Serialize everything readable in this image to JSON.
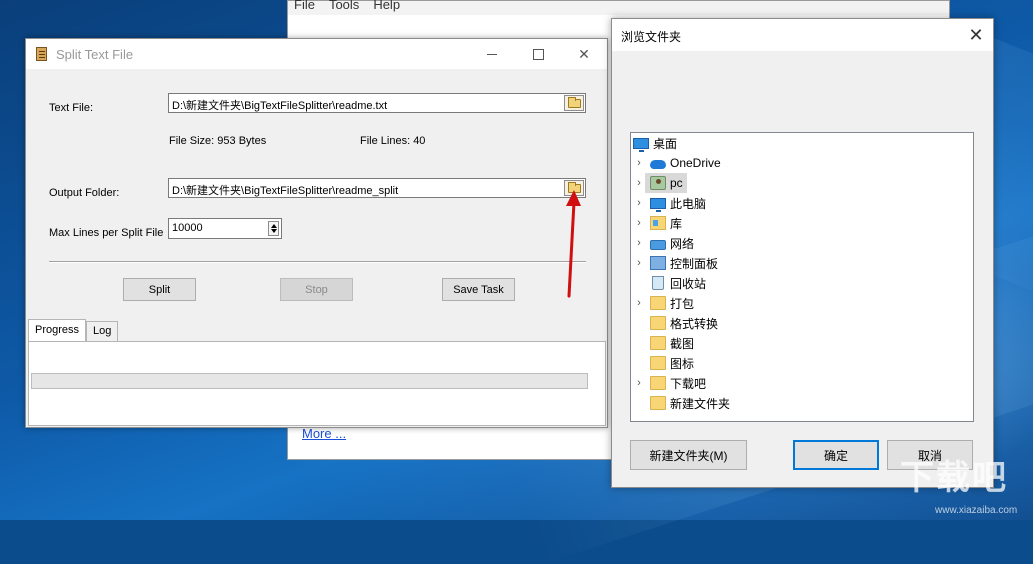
{
  "background_app": {
    "menu": [
      "File",
      "Tools",
      "Help"
    ],
    "more_link": "More ..."
  },
  "main_window": {
    "title": "Split Text File",
    "close_glyph": "✕",
    "text_file_label": "Text File:",
    "text_file_value": "D:\\新建文件夹\\BigTextFileSplitter\\readme.txt",
    "file_size": "File Size: 953 Bytes",
    "file_lines": "File Lines: 40",
    "output_folder_label": "Output Folder:",
    "output_folder_value": "D:\\新建文件夹\\BigTextFileSplitter\\readme_split",
    "max_lines_label": "Max Lines per Split File",
    "max_lines_value": "10000",
    "split_button": "Split",
    "stop_button": "Stop",
    "save_task_button": "Save Task",
    "tabs": [
      "Progress",
      "Log"
    ],
    "progress": 0
  },
  "browse_dialog": {
    "title": "浏览文件夹",
    "close_glyph": "✕",
    "tree": [
      {
        "label": "桌面",
        "icon": "desktop-icon",
        "expandable": false,
        "indent": 0
      },
      {
        "label": "OneDrive",
        "icon": "onedrive-icon",
        "expandable": true,
        "indent": 1
      },
      {
        "label": "pc",
        "icon": "user-folder-icon",
        "expandable": true,
        "indent": 1,
        "selected": true
      },
      {
        "label": "此电脑",
        "icon": "this-pc-icon",
        "expandable": true,
        "indent": 1
      },
      {
        "label": "库",
        "icon": "libraries-icon",
        "expandable": true,
        "indent": 1
      },
      {
        "label": "网络",
        "icon": "network-icon",
        "expandable": true,
        "indent": 1
      },
      {
        "label": "控制面板",
        "icon": "control-panel-icon",
        "expandable": true,
        "indent": 1
      },
      {
        "label": "回收站",
        "icon": "recycle-bin-icon",
        "expandable": false,
        "indent": 1
      },
      {
        "label": "打包",
        "icon": "folder-icon",
        "expandable": true,
        "indent": 1
      },
      {
        "label": "格式转换",
        "icon": "folder-icon",
        "expandable": false,
        "indent": 1
      },
      {
        "label": "截图",
        "icon": "folder-icon",
        "expandable": false,
        "indent": 1
      },
      {
        "label": "图标",
        "icon": "folder-icon",
        "expandable": false,
        "indent": 1
      },
      {
        "label": "下载吧",
        "icon": "folder-icon",
        "expandable": true,
        "indent": 1
      },
      {
        "label": "新建文件夹",
        "icon": "folder-icon",
        "expandable": false,
        "indent": 1
      }
    ],
    "new_folder_button": "新建文件夹(M)",
    "ok_button": "确定",
    "cancel_button": "取消"
  },
  "watermark": {
    "text": "下载吧",
    "sub": "www.xiazaiba.com"
  },
  "colors": {
    "accent": "#0078d7",
    "annotation_arrow": "#d01010"
  }
}
